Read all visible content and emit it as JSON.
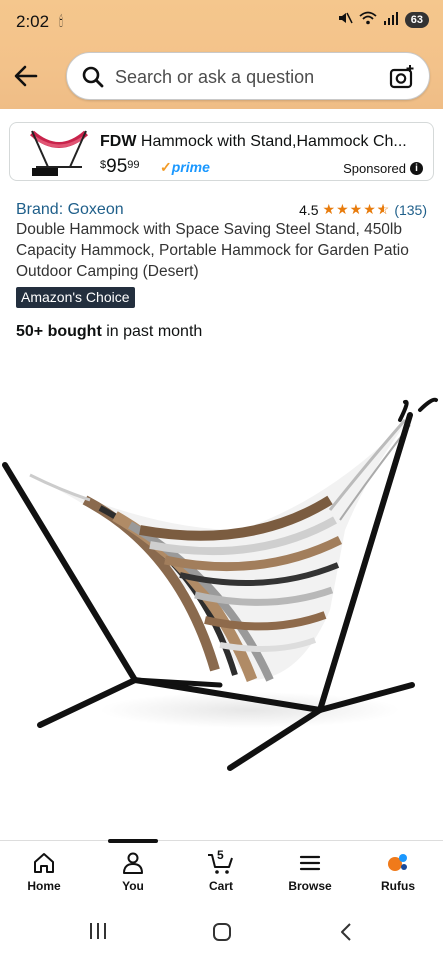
{
  "status_bar": {
    "time": "2:02",
    "battery": "63",
    "icons": [
      "mute-icon",
      "wifi-icon",
      "signal-icon"
    ]
  },
  "search": {
    "placeholder": "Search or ask a question"
  },
  "sponsored_ad": {
    "title_bold": "FDW",
    "title_rest": " Hammock with Stand,Hammock Ch...",
    "price_dollars": "95",
    "price_cents": "99",
    "price_symbol": "$",
    "prime_label": "prime",
    "sponsored_label": "Sponsored"
  },
  "product": {
    "brand": "Brand: Goxeon",
    "rating_value": "4.5",
    "rating_stars": 4.5,
    "rating_count": "(135)",
    "title": "Double Hammock with Space Saving Steel Stand, 450lb Capacity Hammock, Portable Hammock for Garden Patio Outdoor Camping (Desert)",
    "badge": "Amazon's Choice",
    "bought_bold": "50+ bought",
    "bought_rest": " in past month"
  },
  "bottom_nav": {
    "items": [
      {
        "label": "Home",
        "icon": "home-icon"
      },
      {
        "label": "You",
        "icon": "person-icon"
      },
      {
        "label": "Cart",
        "icon": "cart-icon",
        "count": "5"
      },
      {
        "label": "Browse",
        "icon": "menu-icon"
      },
      {
        "label": "Rufus",
        "icon": "rufus-icon"
      }
    ]
  },
  "colors": {
    "header_bg": "#f3c28a",
    "link": "#1f5f8a",
    "star": "#e87c0d",
    "badge_bg": "#232f3e",
    "prime": "#1a98ff"
  }
}
